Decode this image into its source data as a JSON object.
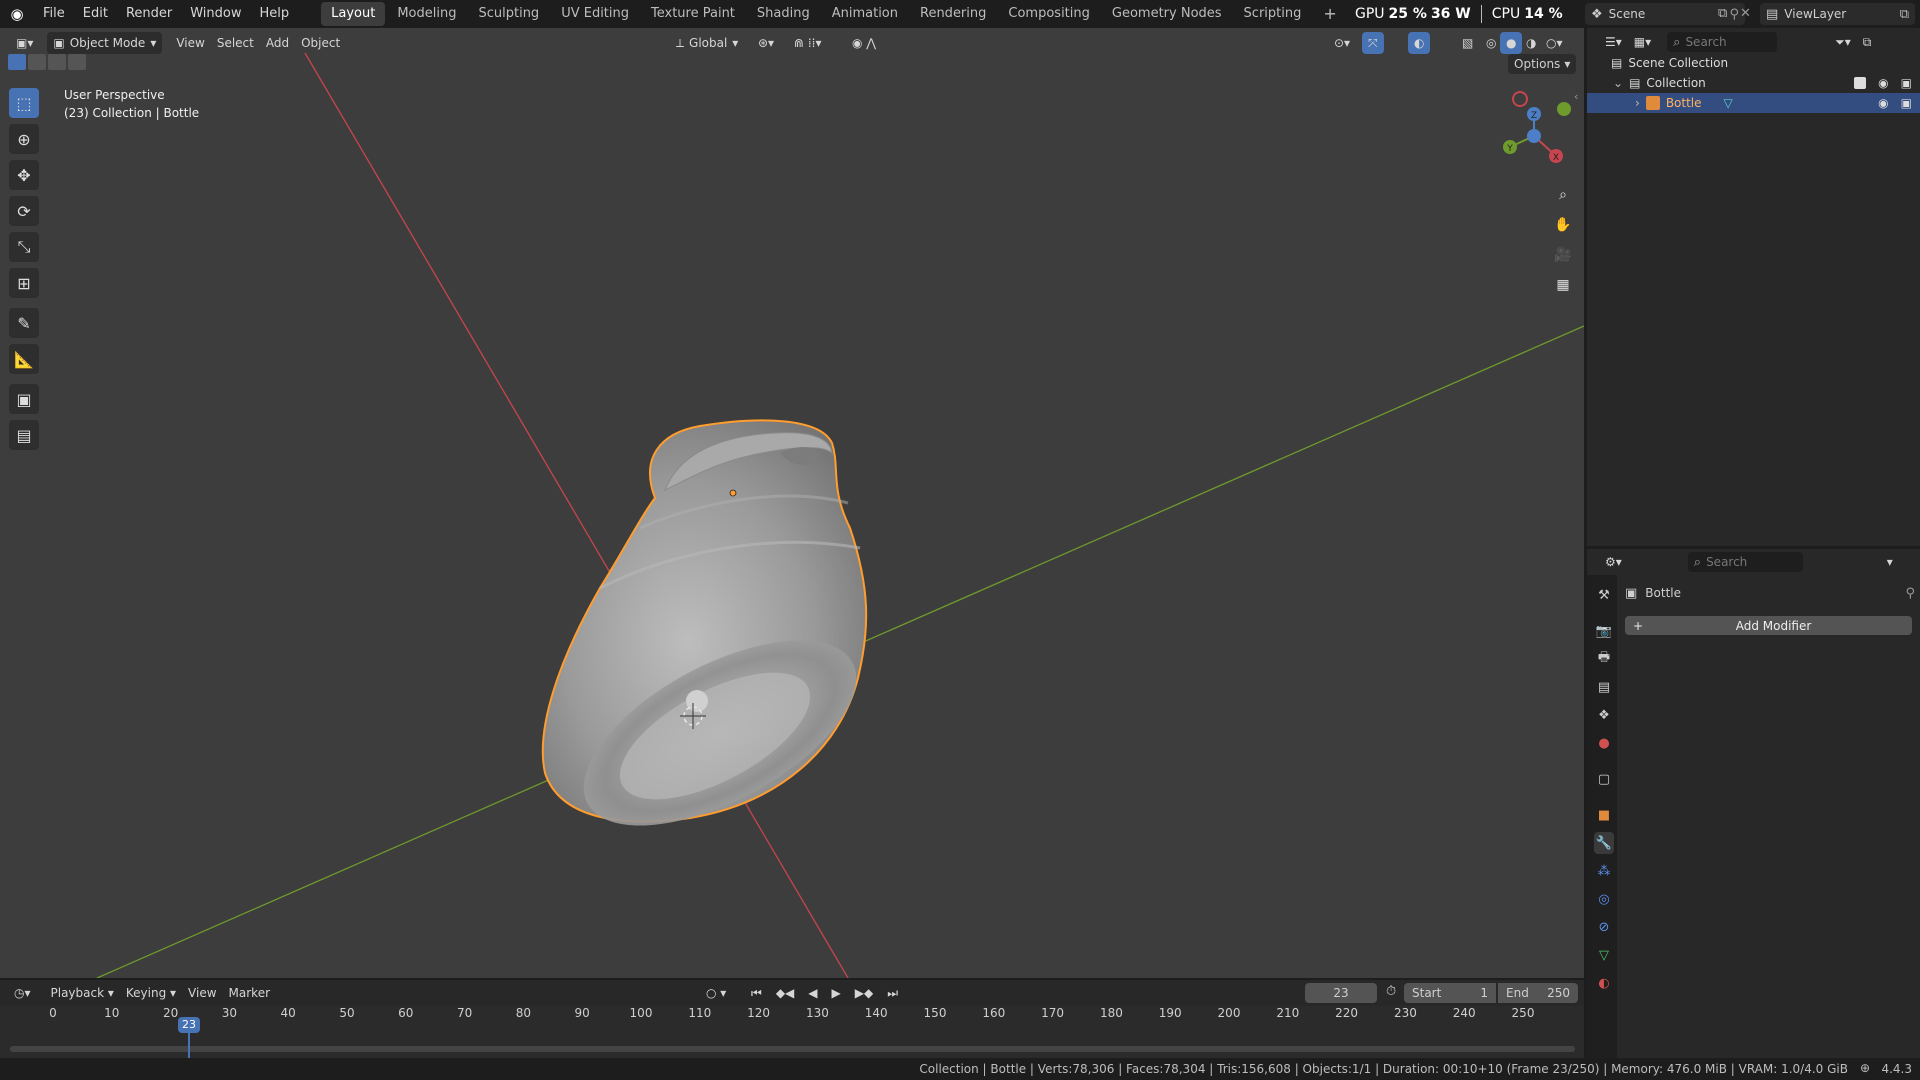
{
  "topbar": {
    "menus": [
      "File",
      "Edit",
      "Render",
      "Window",
      "Help"
    ],
    "workspaces": [
      "Layout",
      "Modeling",
      "Sculpting",
      "UV Editing",
      "Texture Paint",
      "Shading",
      "Animation",
      "Rendering",
      "Compositing",
      "Geometry Nodes",
      "Scripting"
    ],
    "active_workspace": "Layout",
    "add_tab": "+",
    "gpu_label": "GPU",
    "gpu_value": "25 %",
    "gpu_power": "36 W",
    "cpu_label": "CPU",
    "cpu_value": "14 %",
    "scene_name": "Scene",
    "view_layer": "ViewLayer"
  },
  "viewport": {
    "mode": "Object Mode",
    "menus": [
      "View",
      "Select",
      "Add",
      "Object"
    ],
    "orientation": "Global",
    "options": "Options",
    "overlay_line1": "User Perspective",
    "overlay_line2": "(23) Collection | Bottle",
    "gizmo_axes": {
      "x": "X",
      "y": "Y",
      "z": "Z"
    },
    "colors": {
      "background": "#3d3d3d",
      "x_axis": "#c6454f",
      "y_axis": "#6f9a2c",
      "selection": "#ff9d2e"
    }
  },
  "outliner": {
    "search_placeholder": "Search",
    "scene_collection": "Scene Collection",
    "collection": "Collection",
    "object": "Bottle"
  },
  "properties": {
    "search_placeholder": "Search",
    "object_name": "Bottle",
    "add_modifier": "Add Modifier"
  },
  "timeline": {
    "menus": [
      "Playback",
      "Keying",
      "View",
      "Marker"
    ],
    "current_frame": "23",
    "start_label": "Start",
    "start_value": "1",
    "end_label": "End",
    "end_value": "250",
    "ticks": [
      "0",
      "10",
      "20",
      "30",
      "40",
      "50",
      "60",
      "70",
      "80",
      "90",
      "100",
      "110",
      "120",
      "130",
      "140",
      "150",
      "160",
      "170",
      "180",
      "190",
      "200",
      "210",
      "220",
      "230",
      "240",
      "250"
    ],
    "playhead": "23"
  },
  "statusbar": {
    "text": "Collection | Bottle | Verts:78,306 | Faces:78,304 | Tris:156,608 | Objects:1/1 | Duration: 00:10+10 (Frame 23/250) | Memory: 476.0 MiB | VRAM: 1.0/4.0 GiB",
    "version": "4.4.3"
  }
}
